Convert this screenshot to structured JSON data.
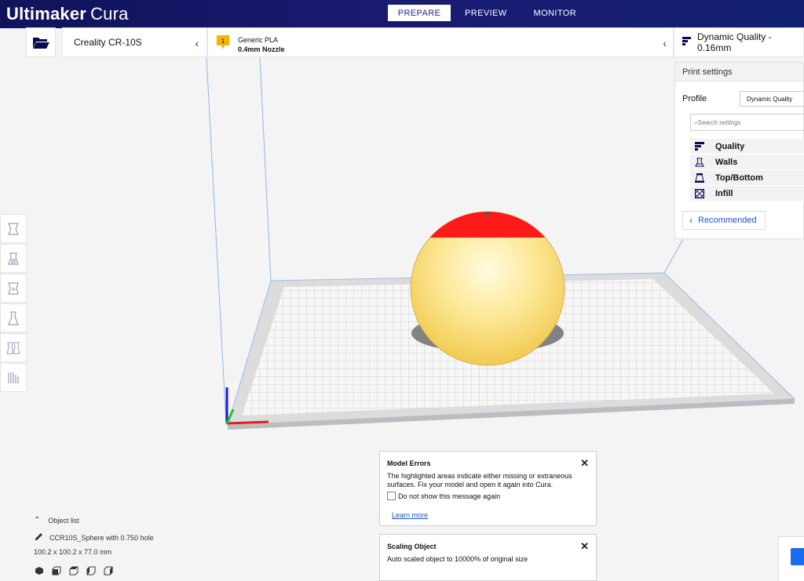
{
  "app": {
    "brand_bold": "Ultimaker",
    "brand_light": "Cura"
  },
  "stages": [
    {
      "label": "PREPARE",
      "active": true
    },
    {
      "label": "PREVIEW",
      "active": false
    },
    {
      "label": "MONITOR",
      "active": false
    }
  ],
  "printer": {
    "name": "Creality CR-10S"
  },
  "material": {
    "extruder_index": "1",
    "name": "Generic PLA",
    "nozzle": "0.4mm Nozzle"
  },
  "quality": {
    "label": "Dynamic Quality - 0.16mm"
  },
  "print_settings": {
    "title": "Print settings",
    "profile_label": "Profile",
    "profile_value": "Dynamic Quality",
    "search_placeholder": "Search settings",
    "categories": [
      {
        "label": "Quality",
        "icon": "quality-icon"
      },
      {
        "label": "Walls",
        "icon": "walls-icon"
      },
      {
        "label": "Top/Bottom",
        "icon": "top-bottom-icon"
      },
      {
        "label": "Infill",
        "icon": "infill-icon"
      }
    ],
    "recommended_label": "Recommended"
  },
  "tools": [
    "move-icon",
    "scale-icon",
    "rotate-icon",
    "mirror-icon",
    "per-model-settings-icon",
    "support-blocker-icon"
  ],
  "messages": {
    "model_errors": {
      "title": "Model Errors",
      "text": "The highlighted areas indicate either missing or extraneous surfaces. Fix your model and open it again into Cura.",
      "checkbox_label": "Do not show this message again",
      "link": "Learn more"
    },
    "scaling": {
      "title": "Scaling Object",
      "text": "Auto scaled object to 10000% of original size"
    }
  },
  "object_list": {
    "toggle_label": "Object list",
    "object_name": "CCR10S_Sphere with 0.750 hole",
    "dimensions": "100.2 x 100.2 x 77.0 mm"
  },
  "colors": {
    "header": "#11135a",
    "accent": "#196ef0",
    "model": "#fde89a",
    "error": "#ff1a1a",
    "badge": "#f2b600"
  }
}
